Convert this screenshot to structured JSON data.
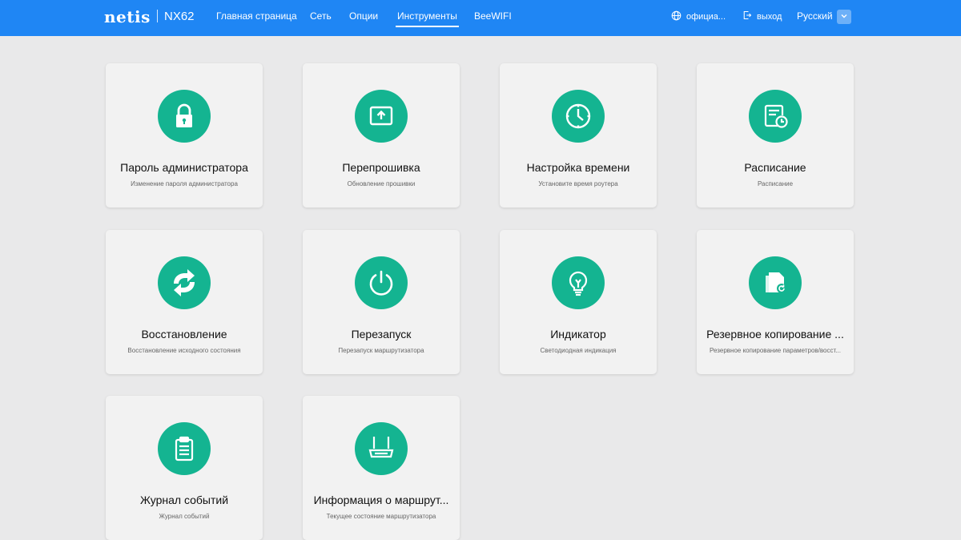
{
  "header": {
    "logo": "netis",
    "model": "NX62",
    "nav": [
      {
        "label": "Главная страница"
      },
      {
        "label": "Сеть"
      },
      {
        "label": "Опции"
      },
      {
        "label": "Инструменты"
      },
      {
        "label": "BeeWIFI"
      }
    ],
    "active_nav": "Инструменты",
    "official_label": "официа...",
    "logout_label": "выход",
    "language": "Русский"
  },
  "colors": {
    "header_bg": "#1f86f4",
    "icon_bg": "#14b491",
    "page_bg": "#e9e9ea",
    "card_bg": "#f2f2f2"
  },
  "cards": [
    {
      "icon": "lock-icon",
      "title": "Пароль администратора",
      "subtitle": "Изменение пароля администратора"
    },
    {
      "icon": "upload-icon",
      "title": "Перепрошивка",
      "subtitle": "Обновление прошивки"
    },
    {
      "icon": "clock-icon",
      "title": "Настройка времени",
      "subtitle": "Установите время роутера"
    },
    {
      "icon": "schedule-icon",
      "title": "Расписание",
      "subtitle": "Расписание"
    },
    {
      "icon": "restore-icon",
      "title": "Восстановление",
      "subtitle": "Восстановление исходного состояния"
    },
    {
      "icon": "power-icon",
      "title": "Перезапуск",
      "subtitle": "Перезапуск маршрутизатора"
    },
    {
      "icon": "bulb-icon",
      "title": "Индикатор",
      "subtitle": "Светодиодная индикация"
    },
    {
      "icon": "backup-icon",
      "title": "Резервное копирование ...",
      "subtitle": "Резервное копирование параметров/восст..."
    },
    {
      "icon": "clipboard-icon",
      "title": "Журнал событий",
      "subtitle": "Журнал событий"
    },
    {
      "icon": "router-icon",
      "title": "Информация о маршрут...",
      "subtitle": "Текущее состояние маршрутизатора"
    }
  ]
}
